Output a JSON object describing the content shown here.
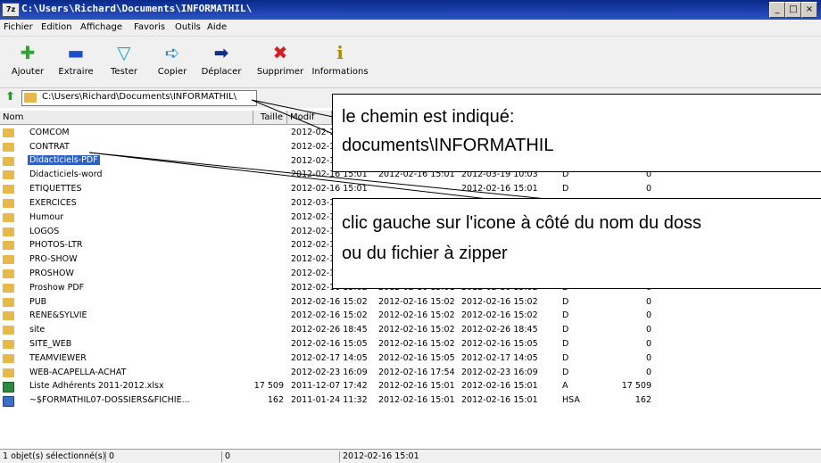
{
  "window": {
    "title": "C:\\Users\\Richard\\Documents\\INFORMATHIL\\",
    "app_icon_text": "7z",
    "controls": [
      "_",
      "□",
      "×"
    ]
  },
  "menu": [
    "Fichier",
    "Edition",
    "Affichage",
    "Favoris",
    "Outils",
    "Aide"
  ],
  "toolbar": [
    {
      "label": "Ajouter",
      "icon": "plus-icon",
      "color": "#2fa52f"
    },
    {
      "label": "Extraire",
      "icon": "minus-icon",
      "color": "#1a4fd0"
    },
    {
      "label": "Tester",
      "icon": "check-icon",
      "color": "#16a9c9"
    },
    {
      "label": "Copier",
      "icon": "copy-arrow-icon",
      "color": "#2a8ad0"
    },
    {
      "label": "Déplacer",
      "icon": "move-arrow-icon",
      "color": "#12308a"
    },
    {
      "label": "Supprimer",
      "icon": "delete-icon",
      "color": "#d21f1f"
    },
    {
      "label": "Informations",
      "icon": "info-icon",
      "color": "#b08a00"
    }
  ],
  "address": "C:\\Users\\Richard\\Documents\\INFORMATHIL\\",
  "columns": [
    "Nom",
    "Taille",
    "Modif"
  ],
  "files": [
    {
      "name": "COMCOM",
      "size": "",
      "modified": "2012-02-1",
      "created": "",
      "accessed": "",
      "attr": "",
      "packed": "",
      "type": "folder"
    },
    {
      "name": "CONTRAT",
      "size": "",
      "modified": "2012-02-1",
      "created": "",
      "accessed": "",
      "attr": "",
      "packed": "",
      "type": "folder"
    },
    {
      "name": "Didacticiels-PDF",
      "size": "",
      "modified": "2012-02-1",
      "created": "",
      "accessed": "",
      "attr": "",
      "packed": "",
      "type": "folder",
      "selected": true
    },
    {
      "name": "Didacticiels-word",
      "size": "",
      "modified": "2012-02-16 15:01",
      "created": "2012-02-16 15:01",
      "accessed": "2012-03-19 10:03",
      "attr": "D",
      "packed": "0",
      "type": "folder"
    },
    {
      "name": "ETIQUETTES",
      "size": "",
      "modified": "2012-02-16 15:01",
      "created": "",
      "accessed": "2012-02-16 15:01",
      "attr": "D",
      "packed": "0",
      "type": "folder"
    },
    {
      "name": "EXERCICES",
      "size": "",
      "modified": "2012-03-1",
      "created": "",
      "accessed": "",
      "attr": "",
      "packed": "",
      "type": "folder"
    },
    {
      "name": "Humour",
      "size": "",
      "modified": "2012-02-1",
      "created": "",
      "accessed": "",
      "attr": "",
      "packed": "",
      "type": "folder"
    },
    {
      "name": "LOGOS",
      "size": "",
      "modified": "2012-02-1",
      "created": "",
      "accessed": "",
      "attr": "",
      "packed": "",
      "type": "folder"
    },
    {
      "name": "PHOTOS-LTR",
      "size": "",
      "modified": "2012-02-1",
      "created": "",
      "accessed": "",
      "attr": "",
      "packed": "",
      "type": "folder"
    },
    {
      "name": "PRO-SHOW",
      "size": "",
      "modified": "2012-02-1",
      "created": "",
      "accessed": "",
      "attr": "",
      "packed": "",
      "type": "folder"
    },
    {
      "name": "PROSHOW",
      "size": "",
      "modified": "2012-02-1",
      "created": "",
      "accessed": "",
      "attr": "",
      "packed": "",
      "type": "folder"
    },
    {
      "name": "Proshow PDF",
      "size": "",
      "modified": "2012-02-16 15:02",
      "created": "2012-02-16 15:01",
      "accessed": "2012-02-16 15:02",
      "attr": "D",
      "packed": "0",
      "type": "folder"
    },
    {
      "name": "PUB",
      "size": "",
      "modified": "2012-02-16 15:02",
      "created": "2012-02-16 15:02",
      "accessed": "2012-02-16 15:02",
      "attr": "D",
      "packed": "0",
      "type": "folder"
    },
    {
      "name": "RENE&SYLVIE",
      "size": "",
      "modified": "2012-02-16 15:02",
      "created": "2012-02-16 15:02",
      "accessed": "2012-02-16 15:02",
      "attr": "D",
      "packed": "0",
      "type": "folder"
    },
    {
      "name": "site",
      "size": "",
      "modified": "2012-02-26 18:45",
      "created": "2012-02-16 15:02",
      "accessed": "2012-02-26 18:45",
      "attr": "D",
      "packed": "0",
      "type": "folder"
    },
    {
      "name": "SITE_WEB",
      "size": "",
      "modified": "2012-02-16 15:05",
      "created": "2012-02-16 15:02",
      "accessed": "2012-02-16 15:05",
      "attr": "D",
      "packed": "0",
      "type": "folder"
    },
    {
      "name": "TEAMVIEWER",
      "size": "",
      "modified": "2012-02-17 14:05",
      "created": "2012-02-16 15:05",
      "accessed": "2012-02-17 14:05",
      "attr": "D",
      "packed": "0",
      "type": "folder"
    },
    {
      "name": "WEB-ACAPELLA-ACHAT",
      "size": "",
      "modified": "2012-02-23 16:09",
      "created": "2012-02-16 17:54",
      "accessed": "2012-02-23 16:09",
      "attr": "D",
      "packed": "0",
      "type": "folder"
    },
    {
      "name": "Liste Adhérents 2011-2012.xlsx",
      "size": "17 509",
      "modified": "2011-12-07 17:42",
      "created": "2012-02-16 15:01",
      "accessed": "2012-02-16 15:01",
      "attr": "A",
      "packed": "17 509",
      "type": "xlsx"
    },
    {
      "name": "~$FORMATHIL07-DOSSIERS&FICHIE...",
      "size": "162",
      "modified": "2011-01-24 11:32",
      "created": "2012-02-16 15:01",
      "accessed": "2012-02-16 15:01",
      "attr": "HSA",
      "packed": "162",
      "type": "doc"
    }
  ],
  "status": [
    "1 objet(s) sélectionné(s)",
    "0",
    "0",
    "2012-02-16 15:01"
  ],
  "callouts": [
    {
      "lines": [
        "le chemin est indiqué:",
        "documents\\INFORMATHIL"
      ]
    },
    {
      "lines": [
        "clic gauche sur l'icone à côté du nom du doss",
        "ou du fichier à zipper"
      ]
    }
  ]
}
